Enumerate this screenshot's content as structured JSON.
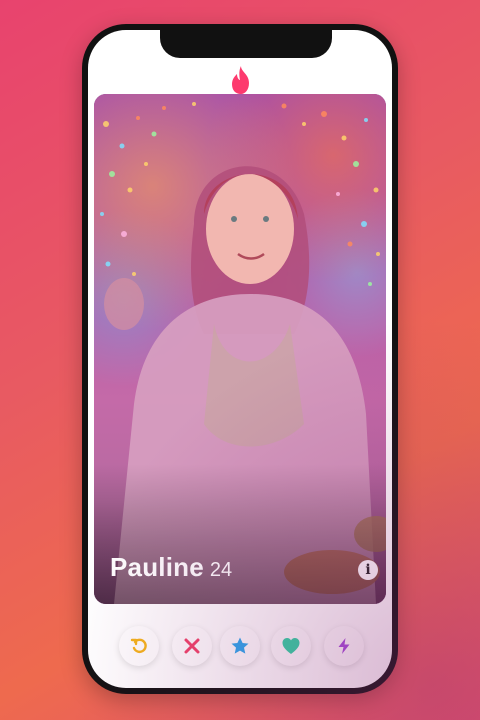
{
  "app": {
    "brand_icon": "flame-logo-icon",
    "accent_color": "#fd3a6e"
  },
  "profile": {
    "name": "Pauline",
    "age": "24",
    "info_icon_glyph": "i",
    "info_icon": "info-icon"
  },
  "actions": [
    {
      "id": "rewind",
      "icon": "rewind-icon",
      "color": "#f5b41a"
    },
    {
      "id": "nope",
      "icon": "close-icon",
      "color": "#f0436a"
    },
    {
      "id": "super-like",
      "icon": "star-icon",
      "color": "#2aa8ef"
    },
    {
      "id": "like",
      "icon": "heart-icon",
      "color": "#2fd6a6"
    },
    {
      "id": "boost",
      "icon": "bolt-icon",
      "color": "#a54ddc"
    }
  ]
}
